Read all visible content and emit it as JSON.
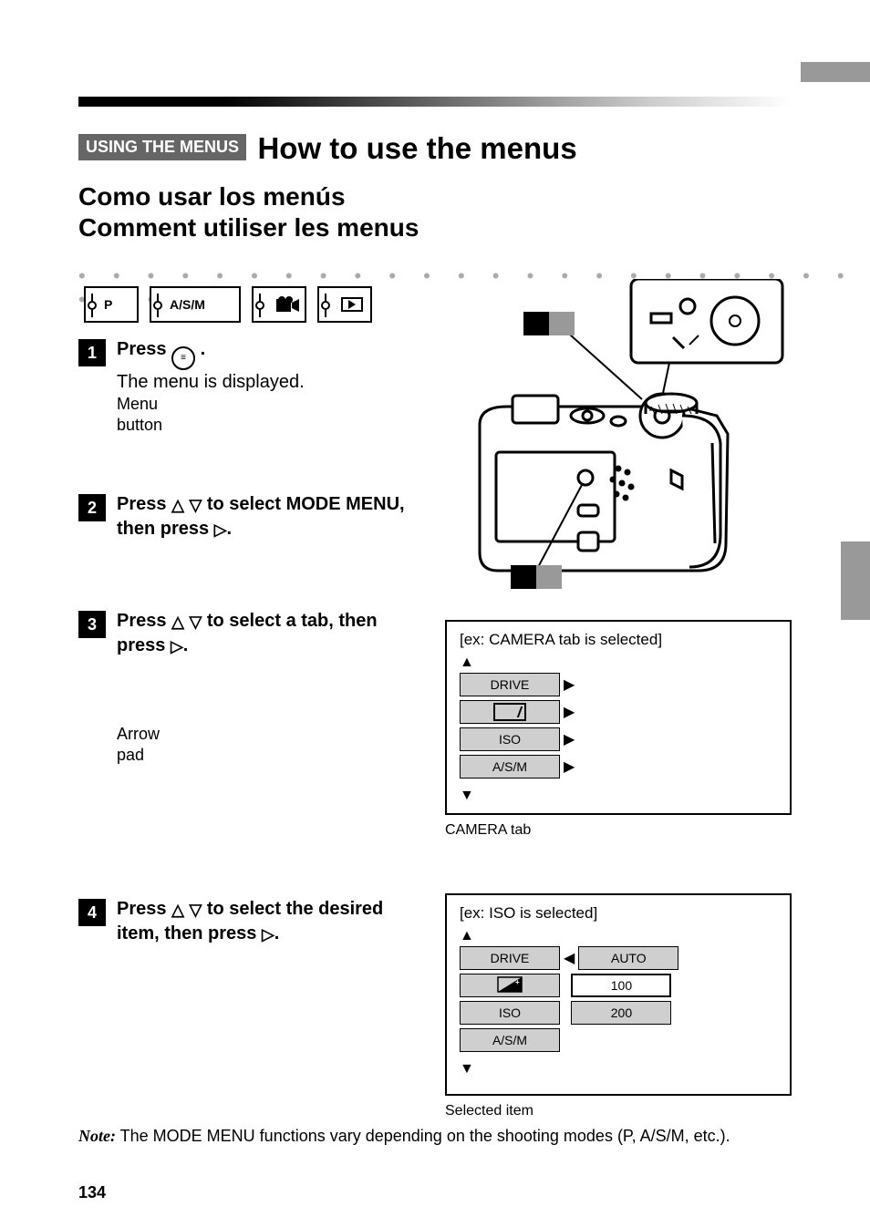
{
  "header": {
    "section_tag": "USING THE MENUS",
    "title": "How to use the menus",
    "subtitle_line1": "Como usar los menús",
    "subtitle_line2": "Comment utiliser les menus"
  },
  "icons": {
    "mode_p": "P",
    "mode_asm": "A/S/M   "
  },
  "steps": {
    "s1_num": "1",
    "s1_text_bold": "Press ",
    "s1_text_icon": "",
    "s1_text_rest": ".",
    "s1_sub": "The menu is displayed.",
    "s2_num": "2",
    "s2_text": "Press  to select MODE MENU, then press  .",
    "s3_num": "3",
    "s3_text": "Press  to select a tab, then press  .",
    "s4_num": "4",
    "s4_text": "Press  to select the desired item, then press  ."
  },
  "screens": {
    "sb1": {
      "title": "[ex: CAMERA tab is selected]",
      "rows": [
        "DRIVE",
        "",
        "ISO",
        "A/S/M"
      ],
      "caption": "CAMERA tab"
    },
    "sb2": {
      "title": "[ex: ISO is selected]",
      "left": [
        "DRIVE",
        "",
        "ISO",
        "A/S/M"
      ],
      "right": [
        "AUTO",
        "100",
        "200"
      ],
      "caption": "Selected item"
    }
  },
  "note": {
    "label": "Note:",
    "text": " The MODE MENU functions vary depending on the shooting modes (P, A/S/M, etc.)."
  },
  "page": "134"
}
